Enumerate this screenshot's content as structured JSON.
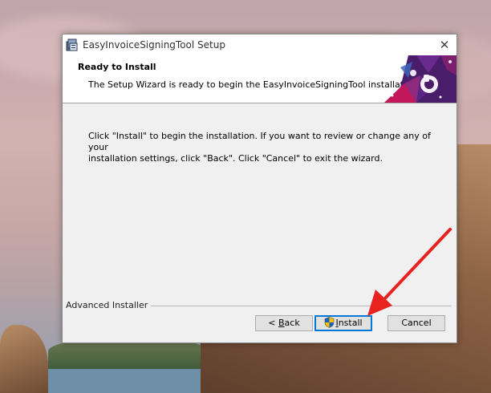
{
  "window": {
    "title": "EasyInvoiceSigningTool Setup"
  },
  "header": {
    "title": "Ready to Install",
    "subtitle": "The Setup Wizard is ready to begin the EasyInvoiceSigningTool installation"
  },
  "body": {
    "line1": "Click \"Install\" to begin the installation.  If you want to review or change any of your",
    "line2": "installation settings, click \"Back\".  Click \"Cancel\" to exit the wizard."
  },
  "footer": {
    "brand": "Advanced Installer"
  },
  "buttons": {
    "back_prefix": "< ",
    "back_underlined": "B",
    "back_rest": "ack",
    "install_underlined": "I",
    "install_rest": "nstall",
    "cancel": "Cancel"
  },
  "colors": {
    "accent": "#0078d7",
    "annotation_arrow": "#e8231f",
    "logo_purple": "#4a1d6b",
    "logo_magenta": "#c2185b"
  }
}
